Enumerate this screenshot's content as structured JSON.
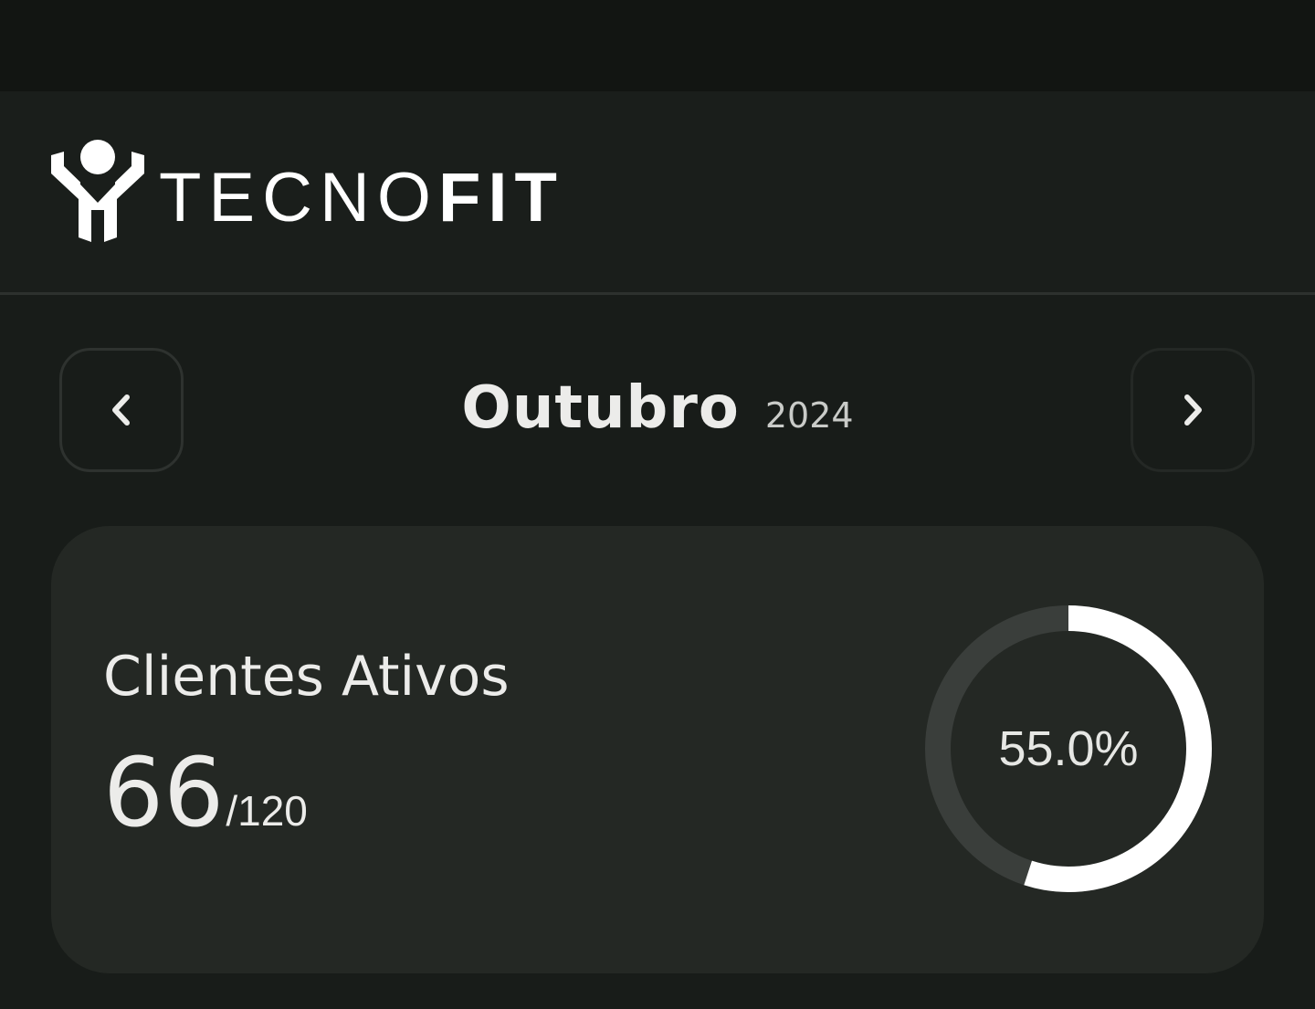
{
  "header": {
    "logo_light": "TECNO",
    "logo_bold": "FIT",
    "logo_icon": "tecnofit-logo-icon"
  },
  "period": {
    "month": "Outubro",
    "year": "2024",
    "prev_icon": "chevron-left-icon",
    "next_icon": "chevron-right-icon"
  },
  "active_clients": {
    "title": "Clientes Ativos",
    "count": "66",
    "total": "/120",
    "percent_label": "55.0%",
    "percent_value": 0.55
  },
  "colors": {
    "background": "#181c19",
    "card": "#242824",
    "ring_track": "#3a3e3b",
    "ring_fill": "#ffffff"
  }
}
